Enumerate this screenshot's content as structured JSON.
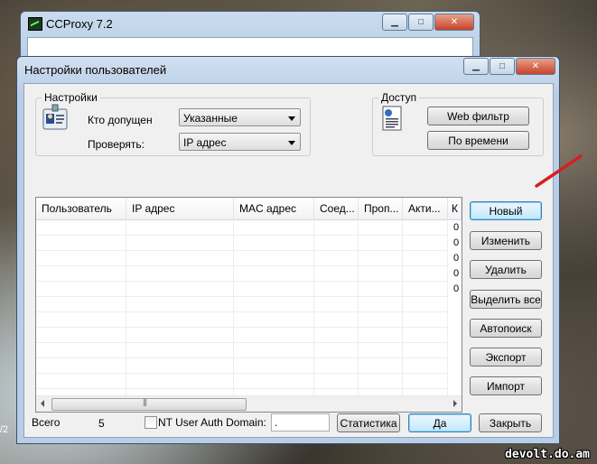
{
  "background_window": {
    "title": "CCProxy 7.2"
  },
  "dialog": {
    "title": "Настройки пользователей",
    "settings": {
      "legend": "Настройки",
      "who_label": "Кто допущен",
      "who_value": "Указанные",
      "check_label": "Проверять:",
      "check_value": "IP адрес"
    },
    "access": {
      "legend": "Доступ",
      "web_filter": "Web фильтр",
      "schedule": "По времени"
    },
    "table": {
      "columns": [
        "Пользователь",
        "IP адрес",
        "MAC адрес",
        "Соед...",
        "Проп...",
        "Акти...",
        "К"
      ],
      "zeros": [
        "0",
        "0",
        "0",
        "0",
        "0"
      ]
    },
    "side_buttons": {
      "new": "Новый",
      "edit": "Изменить",
      "delete": "Удалить",
      "select_all": "Выделить все",
      "autofind": "Автопоиск",
      "export": "Экспорт",
      "import": "Импорт"
    },
    "footer": {
      "total_label": "Всего",
      "total_value": "5",
      "nt_auth_label": "NT User Auth Domain:",
      "nt_auth_value": ".",
      "stats": "Статистика",
      "ok": "Да",
      "close": "Закрыть"
    }
  },
  "watermark": "devolt.do.am",
  "edge_text": "/2",
  "colors": {
    "accent_arrow": "#d62020",
    "close_button": "#c7432a"
  }
}
